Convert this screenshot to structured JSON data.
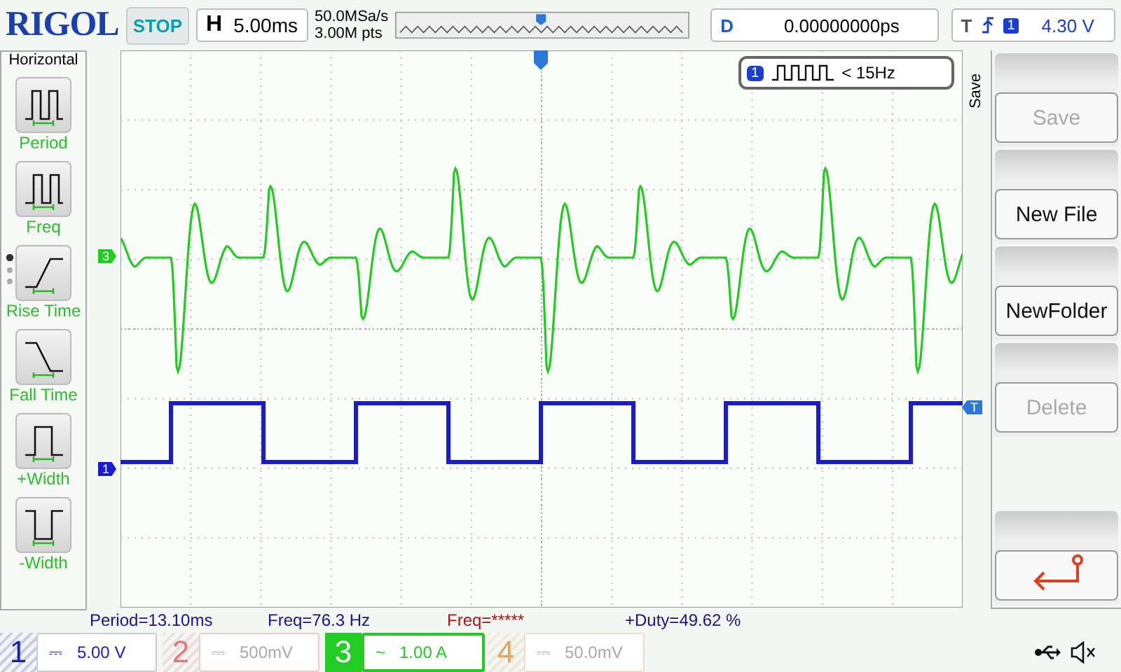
{
  "header": {
    "logo": "RIGOL",
    "run_state": "STOP",
    "timebase": {
      "label": "H",
      "value": "5.00ms"
    },
    "sample_rate": "50.0MSa/s",
    "memory_depth": "3.00M pts",
    "delay": {
      "label": "D",
      "value": "0.00000000ps"
    },
    "trigger": {
      "label": "T",
      "source": "1",
      "level": "4.30 V"
    }
  },
  "left_menu": {
    "title": "Horizontal",
    "items": [
      {
        "label": "Period",
        "kind": "period"
      },
      {
        "label": "Freq",
        "kind": "freq"
      },
      {
        "label": "Rise Time",
        "kind": "rise"
      },
      {
        "label": "Fall Time",
        "kind": "fall"
      },
      {
        "label": "+Width",
        "kind": "pwidth"
      },
      {
        "label": "-Width",
        "kind": "nwidth"
      }
    ]
  },
  "scope": {
    "trigger_readout": {
      "channel": "1",
      "text": "< 15Hz"
    },
    "trace_markers": [
      {
        "label": "3",
        "color": "#22cc22"
      },
      {
        "label": "1",
        "color": "#1a1ad0"
      }
    ],
    "trigger_marker": "T"
  },
  "right_menu": {
    "title": "Save",
    "buttons": [
      {
        "kind": "text",
        "label": "Save",
        "disabled": true
      },
      {
        "kind": "text",
        "label": "New File",
        "disabled": false
      },
      {
        "kind": "text",
        "label": "NewFolder",
        "disabled": false
      },
      {
        "kind": "text",
        "label": "Delete",
        "disabled": true
      },
      {
        "kind": "back",
        "disabled": false
      }
    ]
  },
  "measurements": [
    {
      "text": "Period=13.10ms",
      "color": "#14148c"
    },
    {
      "text": "Freq=76.3 Hz",
      "color": "#14148c"
    },
    {
      "text": "Freq=*****",
      "color": "#b01010"
    },
    {
      "text": "+Duty=49.62 %",
      "color": "#14148c"
    }
  ],
  "channels": [
    {
      "number": "1",
      "coupling": "⎓",
      "scale": "5.00 V",
      "color": "#1a1ad0",
      "enabled": true,
      "selected": false
    },
    {
      "number": "2",
      "coupling": "⎓",
      "scale": "500mV",
      "color": "#e07878",
      "enabled": false,
      "selected": false
    },
    {
      "number": "3",
      "coupling": "~",
      "scale": "1.00 A",
      "color": "#22cc22",
      "enabled": true,
      "selected": true
    },
    {
      "number": "4",
      "coupling": "⎓",
      "scale": "50.0mV",
      "color": "#e0a868",
      "enabled": false,
      "selected": false
    }
  ]
}
